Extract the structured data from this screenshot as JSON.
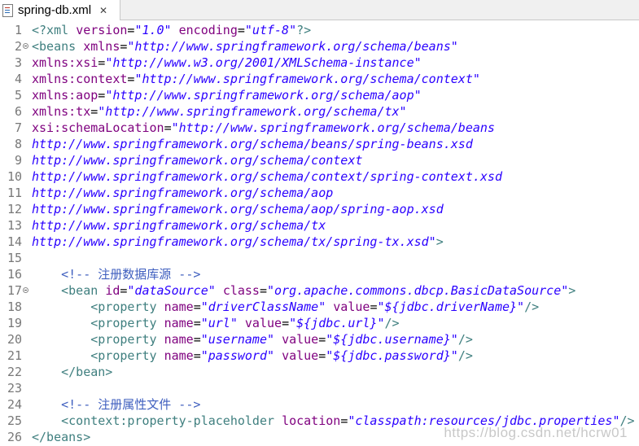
{
  "tab": {
    "title": "spring-db.xml",
    "close_glyph": "✕",
    "icon": "xml-file-icon"
  },
  "colors": {
    "tag": "#3f7f7f",
    "attr": "#7f007f",
    "value": "#2a00ff",
    "comment": "#3f5fbf",
    "gutter": "#787878"
  },
  "watermark": "https://blog.csdn.net/hcrw01",
  "lines": [
    {
      "n": "1",
      "fold": false,
      "parts": [
        [
          "tag",
          "<?xml "
        ],
        [
          "attr",
          "version"
        ],
        [
          "txt",
          "="
        ],
        [
          "val",
          "\"1.0\""
        ],
        [
          "txt",
          " "
        ],
        [
          "attr",
          "encoding"
        ],
        [
          "txt",
          "="
        ],
        [
          "val",
          "\"utf-8\""
        ],
        [
          "tag",
          "?>"
        ]
      ]
    },
    {
      "n": "2",
      "fold": true,
      "parts": [
        [
          "tag",
          "<beans "
        ],
        [
          "attr",
          "xmlns"
        ],
        [
          "txt",
          "="
        ],
        [
          "val",
          "\"http://www.springframework.org/schema/beans\""
        ]
      ]
    },
    {
      "n": "3",
      "fold": false,
      "parts": [
        [
          "attr",
          "xmlns:xsi"
        ],
        [
          "txt",
          "="
        ],
        [
          "val",
          "\"http://www.w3.org/2001/XMLSchema-instance\""
        ]
      ]
    },
    {
      "n": "4",
      "fold": false,
      "parts": [
        [
          "attr",
          "xmlns:context"
        ],
        [
          "txt",
          "="
        ],
        [
          "val",
          "\"http://www.springframework.org/schema/context\""
        ]
      ]
    },
    {
      "n": "5",
      "fold": false,
      "parts": [
        [
          "attr",
          "xmlns:aop"
        ],
        [
          "txt",
          "="
        ],
        [
          "val",
          "\"http://www.springframework.org/schema/aop\""
        ]
      ]
    },
    {
      "n": "6",
      "fold": false,
      "parts": [
        [
          "attr",
          "xmlns:tx"
        ],
        [
          "txt",
          "="
        ],
        [
          "val",
          "\"http://www.springframework.org/schema/tx\""
        ]
      ]
    },
    {
      "n": "7",
      "fold": false,
      "parts": [
        [
          "attr",
          "xsi:schemaLocation"
        ],
        [
          "txt",
          "="
        ],
        [
          "val",
          "\"http://www.springframework.org/schema/beans"
        ]
      ]
    },
    {
      "n": "8",
      "fold": false,
      "parts": [
        [
          "val",
          "http://www.springframework.org/schema/beans/spring-beans.xsd"
        ]
      ]
    },
    {
      "n": "9",
      "fold": false,
      "parts": [
        [
          "val",
          "http://www.springframework.org/schema/context"
        ]
      ]
    },
    {
      "n": "10",
      "fold": false,
      "parts": [
        [
          "val",
          "http://www.springframework.org/schema/context/spring-context.xsd"
        ]
      ]
    },
    {
      "n": "11",
      "fold": false,
      "parts": [
        [
          "val",
          "http://www.springframework.org/schema/aop"
        ]
      ]
    },
    {
      "n": "12",
      "fold": false,
      "parts": [
        [
          "val",
          "http://www.springframework.org/schema/aop/spring-aop.xsd"
        ]
      ]
    },
    {
      "n": "13",
      "fold": false,
      "parts": [
        [
          "val",
          "http://www.springframework.org/schema/tx"
        ]
      ]
    },
    {
      "n": "14",
      "fold": false,
      "parts": [
        [
          "val",
          "http://www.springframework.org/schema/tx/spring-tx.xsd\""
        ],
        [
          "tag",
          ">"
        ]
      ]
    },
    {
      "n": "15",
      "fold": false,
      "parts": []
    },
    {
      "n": "16",
      "fold": false,
      "parts": [
        [
          "txt",
          "    "
        ],
        [
          "cmt",
          "<!-- 注册数据库源 -->"
        ]
      ]
    },
    {
      "n": "17",
      "fold": true,
      "parts": [
        [
          "txt",
          "    "
        ],
        [
          "tag",
          "<bean "
        ],
        [
          "attr",
          "id"
        ],
        [
          "txt",
          "="
        ],
        [
          "val",
          "\"dataSource\""
        ],
        [
          "txt",
          " "
        ],
        [
          "attr",
          "class"
        ],
        [
          "txt",
          "="
        ],
        [
          "val",
          "\"org.apache.commons.dbcp.BasicDataSource\""
        ],
        [
          "tag",
          ">"
        ]
      ]
    },
    {
      "n": "18",
      "fold": false,
      "parts": [
        [
          "txt",
          "        "
        ],
        [
          "tag",
          "<property "
        ],
        [
          "attr",
          "name"
        ],
        [
          "txt",
          "="
        ],
        [
          "val",
          "\"driverClassName\""
        ],
        [
          "txt",
          " "
        ],
        [
          "attr",
          "value"
        ],
        [
          "txt",
          "="
        ],
        [
          "val",
          "\"${jdbc.driverName}\""
        ],
        [
          "tag",
          "/>"
        ]
      ]
    },
    {
      "n": "19",
      "fold": false,
      "parts": [
        [
          "txt",
          "        "
        ],
        [
          "tag",
          "<property "
        ],
        [
          "attr",
          "name"
        ],
        [
          "txt",
          "="
        ],
        [
          "val",
          "\"url\""
        ],
        [
          "txt",
          " "
        ],
        [
          "attr",
          "value"
        ],
        [
          "txt",
          "="
        ],
        [
          "val",
          "\"${jdbc.url}\""
        ],
        [
          "tag",
          "/>"
        ]
      ]
    },
    {
      "n": "20",
      "fold": false,
      "parts": [
        [
          "txt",
          "        "
        ],
        [
          "tag",
          "<property "
        ],
        [
          "attr",
          "name"
        ],
        [
          "txt",
          "="
        ],
        [
          "val",
          "\"username\""
        ],
        [
          "txt",
          " "
        ],
        [
          "attr",
          "value"
        ],
        [
          "txt",
          "="
        ],
        [
          "val",
          "\"${jdbc.username}\""
        ],
        [
          "tag",
          "/>"
        ]
      ]
    },
    {
      "n": "21",
      "fold": false,
      "parts": [
        [
          "txt",
          "        "
        ],
        [
          "tag",
          "<property "
        ],
        [
          "attr",
          "name"
        ],
        [
          "txt",
          "="
        ],
        [
          "val",
          "\"password\""
        ],
        [
          "txt",
          " "
        ],
        [
          "attr",
          "value"
        ],
        [
          "txt",
          "="
        ],
        [
          "val",
          "\"${jdbc.password}\""
        ],
        [
          "tag",
          "/>"
        ]
      ]
    },
    {
      "n": "22",
      "fold": false,
      "parts": [
        [
          "txt",
          "    "
        ],
        [
          "tag",
          "</bean>"
        ]
      ]
    },
    {
      "n": "23",
      "fold": false,
      "parts": []
    },
    {
      "n": "24",
      "fold": false,
      "parts": [
        [
          "txt",
          "    "
        ],
        [
          "cmt",
          "<!-- 注册属性文件 -->"
        ]
      ]
    },
    {
      "n": "25",
      "fold": false,
      "parts": [
        [
          "txt",
          "    "
        ],
        [
          "tag",
          "<context:property-placeholder "
        ],
        [
          "attr",
          "location"
        ],
        [
          "txt",
          "="
        ],
        [
          "val",
          "\"classpath:resources/jdbc.properties\""
        ],
        [
          "tag",
          "/>"
        ]
      ]
    },
    {
      "n": "26",
      "fold": false,
      "parts": [
        [
          "tag",
          "</beans>"
        ]
      ]
    }
  ]
}
